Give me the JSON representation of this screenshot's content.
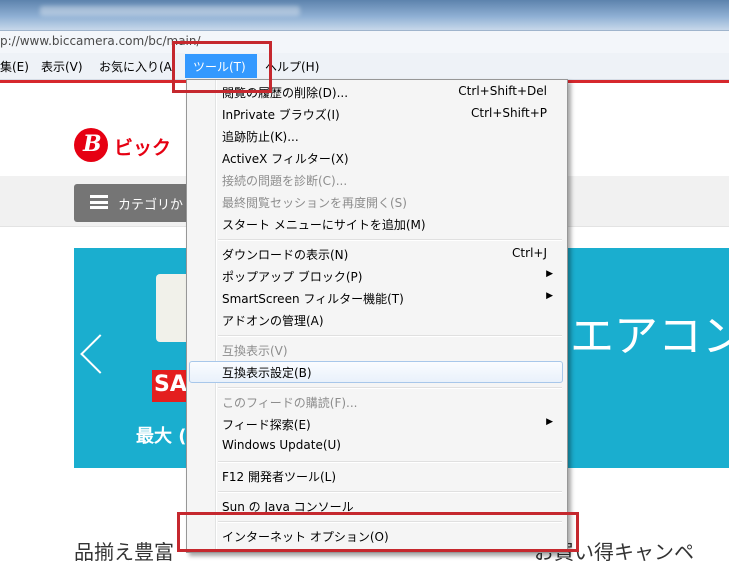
{
  "browser": {
    "url": "p://www.biccamera.com/bc/main/"
  },
  "menubar": {
    "items": [
      {
        "label": "集(E)"
      },
      {
        "label": "表示(V)"
      },
      {
        "label": "お気に入り(A"
      },
      {
        "label": "ツール(T)"
      },
      {
        "label": "ヘルプ(H)"
      }
    ]
  },
  "page": {
    "logo_letter": "B",
    "logo_text": "ビック",
    "category_button": "カテゴリか",
    "banner": {
      "sale_text": "SA",
      "max_text": "最大 (",
      "headline": "エアコン"
    },
    "bottom_left": "品揃え豊富",
    "bottom_right": "お買い得キャンペ"
  },
  "tools_menu": {
    "items": [
      {
        "label": "閲覧の履歴の削除(D)...",
        "shortcut": "Ctrl+Shift+Del",
        "disabled": false
      },
      {
        "label": "InPrivate ブラウズ(I)",
        "shortcut": "Ctrl+Shift+P",
        "disabled": false
      },
      {
        "label": "追跡防止(K)...",
        "shortcut": "",
        "disabled": false
      },
      {
        "label": "ActiveX フィルター(X)",
        "shortcut": "",
        "disabled": false
      },
      {
        "label": "接続の問題を診断(C)...",
        "shortcut": "",
        "disabled": true
      },
      {
        "label": "最終閲覧セッションを再度開く(S)",
        "shortcut": "",
        "disabled": true
      },
      {
        "label": "スタート メニューにサイトを追加(M)",
        "shortcut": "",
        "disabled": false
      },
      {
        "label": "ダウンロードの表示(N)",
        "shortcut": "Ctrl+J",
        "disabled": false
      },
      {
        "label": "ポップアップ ブロック(P)",
        "shortcut": "",
        "disabled": false,
        "submenu": true
      },
      {
        "label": "SmartScreen フィルター機能(T)",
        "shortcut": "",
        "disabled": false,
        "submenu": true
      },
      {
        "label": "アドオンの管理(A)",
        "shortcut": "",
        "disabled": false
      },
      {
        "label": "互換表示(V)",
        "shortcut": "",
        "disabled": true
      },
      {
        "label": "互換表示設定(B)",
        "shortcut": "",
        "disabled": false,
        "hovered": true
      },
      {
        "label": "このフィードの購読(F)...",
        "shortcut": "",
        "disabled": true
      },
      {
        "label": "フィード探索(E)",
        "shortcut": "",
        "disabled": false,
        "submenu": true
      },
      {
        "label": "Windows Update(U)",
        "shortcut": "",
        "disabled": false
      },
      {
        "label": "F12 開発者ツール(L)",
        "shortcut": "",
        "disabled": false
      },
      {
        "label": "Sun の Java コンソール",
        "shortcut": "",
        "disabled": false
      },
      {
        "label": "インターネット オプション(O)",
        "shortcut": "",
        "disabled": false
      }
    ]
  },
  "colors": {
    "menu_highlight": "#3399ff",
    "annotation_red": "#c5282e",
    "brand_red": "#e60012",
    "banner_blue": "#1aaecf"
  }
}
